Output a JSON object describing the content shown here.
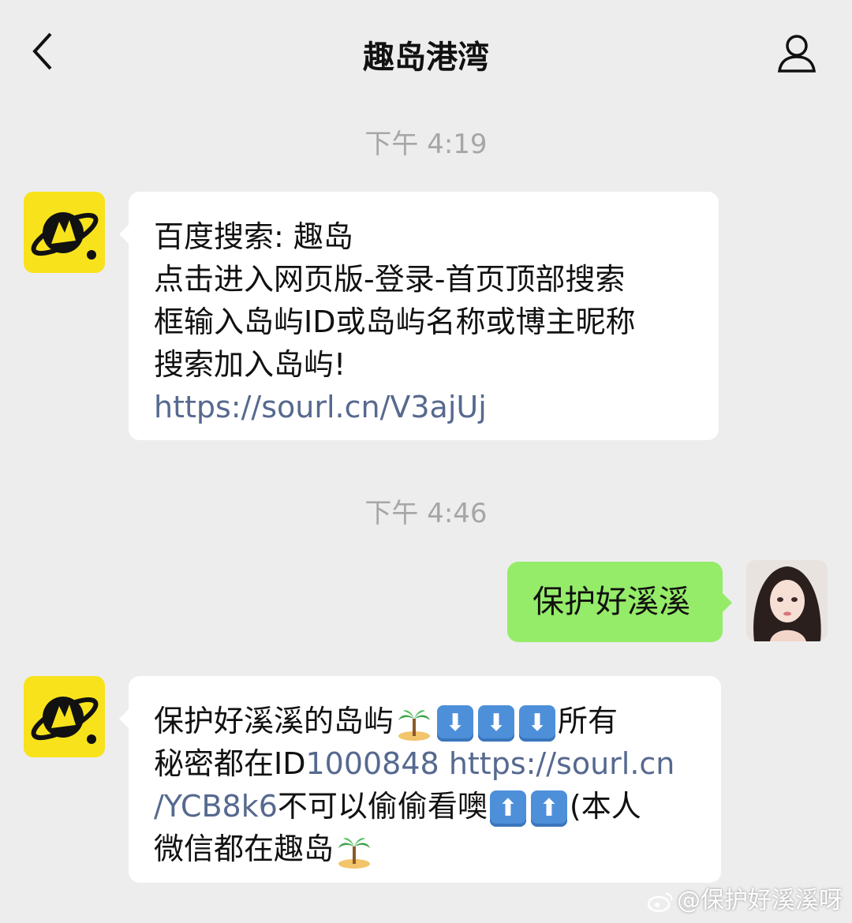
{
  "header": {
    "title": "趣岛港湾",
    "back_icon": "back-arrow-icon",
    "profile_icon": "person-icon"
  },
  "messages": [
    {
      "time": "下午 4:19",
      "sender": "bot",
      "lines": [
        "百度搜索: 趣岛",
        "点击进入网页版-登录-首页顶部搜索",
        "框输入岛屿ID或岛屿名称或博主昵称",
        "搜索加入岛屿!"
      ],
      "link": "https://sourl.cn/V3ajUj"
    },
    {
      "time": "下午 4:46",
      "sender": "me",
      "text": "保护好溪溪"
    },
    {
      "sender": "bot",
      "line1_text": "保护好溪溪的岛屿",
      "line1_tail": "所有",
      "line2_text": "秘密都在ID",
      "line2_id": "1000848",
      "line2_link": "https://sourl.cn",
      "line3_link": "/YCB8k6",
      "line3_text": "不可以偷偷看噢",
      "line3_tail": "(本人",
      "line4_text": "微信都在趣岛",
      "emoji_names": [
        "palm-island-icon",
        "down-arrow-key-icon",
        "up-arrow-key-icon"
      ]
    }
  ],
  "watermark": "@保护好溪溪呀",
  "colors": {
    "background": "#ededed",
    "bot_bubble": "#ffffff",
    "my_bubble": "#95ec69",
    "link": "#56698f",
    "timestamp": "#a6a6a6",
    "bot_avatar": "#f8e21b"
  }
}
